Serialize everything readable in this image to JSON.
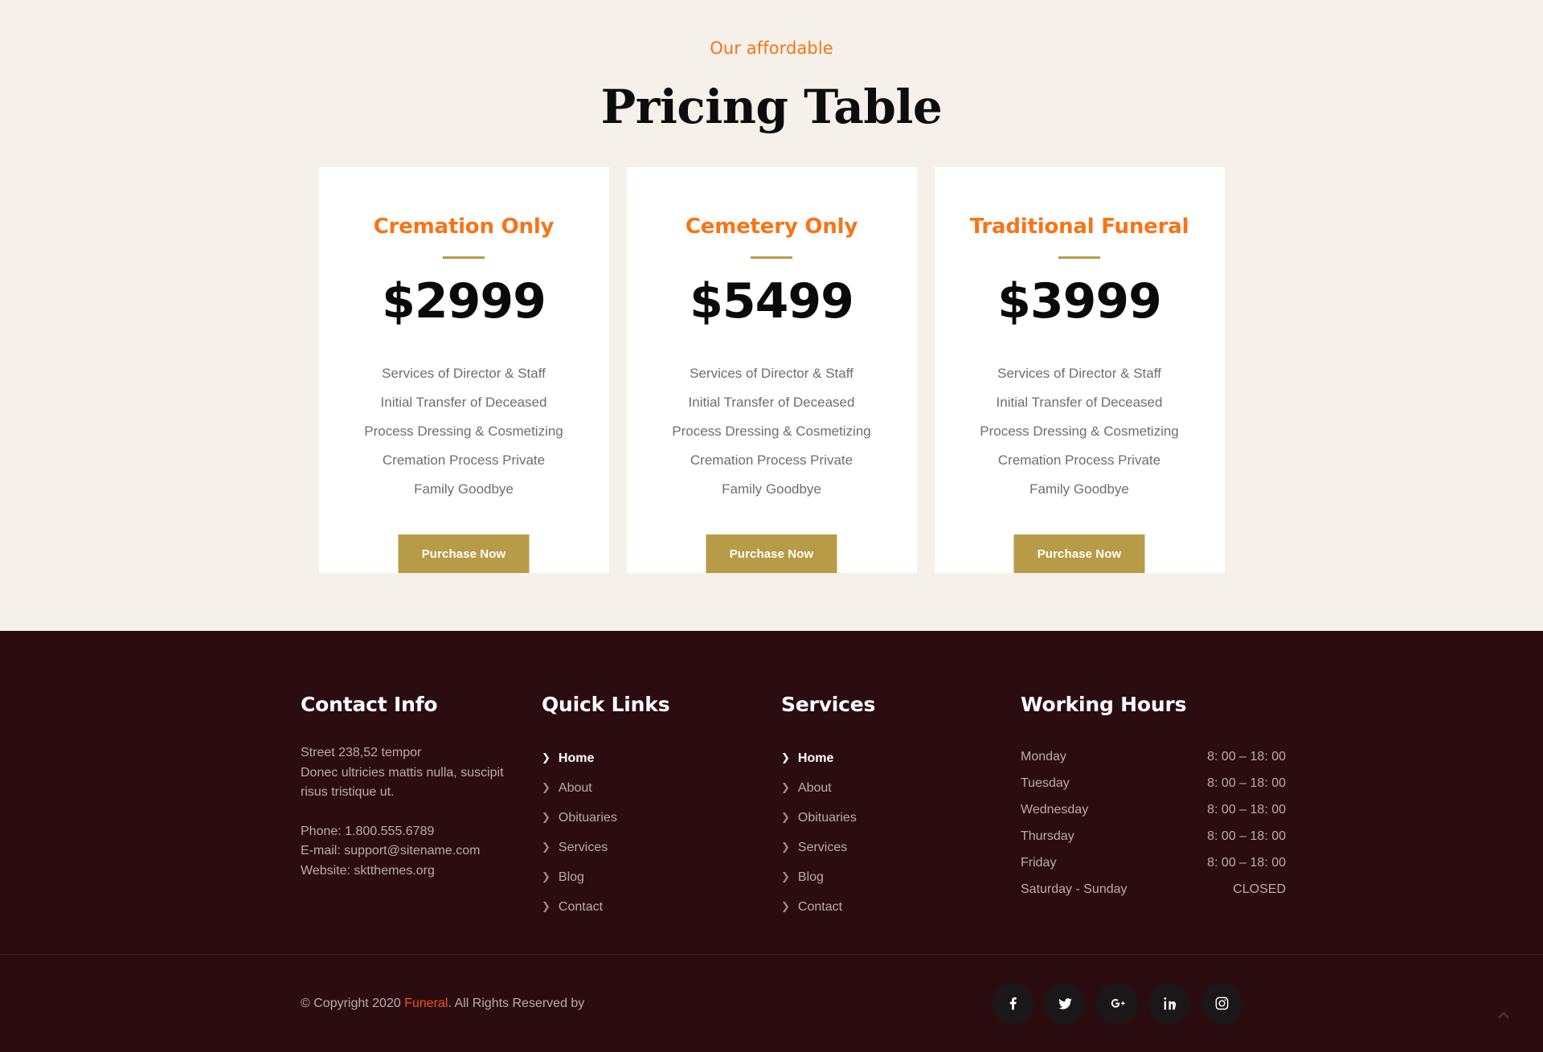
{
  "pricing": {
    "eyebrow": "Our affordable",
    "title": "Pricing Table",
    "accent_orange": "#F97316",
    "accent_gold": "#B89B47",
    "page_bg": "#F5F1EA",
    "cards": [
      {
        "title": "Cremation Only",
        "price": "$2999",
        "features": [
          "Services of Director & Staff",
          "Initial Transfer of Deceased",
          "Process Dressing & Cosmetizing",
          "Cremation Process Private",
          "Family Goodbye"
        ],
        "button": "Purchase Now"
      },
      {
        "title": "Cemetery Only",
        "price": "$5499",
        "features": [
          "Services of Director & Staff",
          "Initial Transfer of Deceased",
          "Process Dressing & Cosmetizing",
          "Cremation Process Private",
          "Family Goodbye"
        ],
        "button": "Purchase Now"
      },
      {
        "title": "Traditional Funeral",
        "price": "$3999",
        "features": [
          "Services of Director & Staff",
          "Initial Transfer of Deceased",
          "Process Dressing & Cosmetizing",
          "Cremation Process Private",
          "Family Goodbye"
        ],
        "button": "Purchase Now"
      }
    ]
  },
  "footer": {
    "bg": "#2B0D11",
    "contact": {
      "heading": "Contact Info",
      "address_line1": "Street 238,52 tempor",
      "address_line2": "Donec ultricies mattis nulla, suscipit",
      "address_line3": "risus tristique ut.",
      "phone": "Phone: 1.800.555.6789",
      "email": "E-mail: support@sitename.com",
      "website": "Website: sktthemes.org"
    },
    "quick_links": {
      "heading": "Quick Links",
      "items": [
        {
          "label": "Home",
          "active": true
        },
        {
          "label": "About",
          "active": false
        },
        {
          "label": "Obituaries",
          "active": false
        },
        {
          "label": "Services",
          "active": false
        },
        {
          "label": "Blog",
          "active": false
        },
        {
          "label": "Contact",
          "active": false
        }
      ]
    },
    "services": {
      "heading": "Services",
      "items": [
        {
          "label": "Home",
          "active": true
        },
        {
          "label": "About",
          "active": false
        },
        {
          "label": "Obituaries",
          "active": false
        },
        {
          "label": "Services",
          "active": false
        },
        {
          "label": "Blog",
          "active": false
        },
        {
          "label": "Contact",
          "active": false
        }
      ]
    },
    "working_hours": {
      "heading": "Working Hours",
      "rows": [
        {
          "day": "Monday",
          "hours": "8: 00 – 18: 00"
        },
        {
          "day": "Tuesday",
          "hours": "8: 00 – 18: 00"
        },
        {
          "day": "Wednesday",
          "hours": "8: 00 – 18: 00"
        },
        {
          "day": "Thursday",
          "hours": "8: 00 – 18: 00"
        },
        {
          "day": "Friday",
          "hours": "8: 00 – 18: 00"
        },
        {
          "day": "Saturday - Sunday",
          "hours": "CLOSED"
        }
      ]
    },
    "copyright": {
      "prefix": "© Copyright 2020 ",
      "brand": "Funeral",
      "suffix": ". All Rights Reserved by"
    },
    "socials": [
      {
        "name": "facebook-icon"
      },
      {
        "name": "twitter-icon"
      },
      {
        "name": "google-plus-icon"
      },
      {
        "name": "linkedin-icon"
      },
      {
        "name": "instagram-icon"
      }
    ],
    "scroll_top_icon": "chevron-up-icon"
  }
}
